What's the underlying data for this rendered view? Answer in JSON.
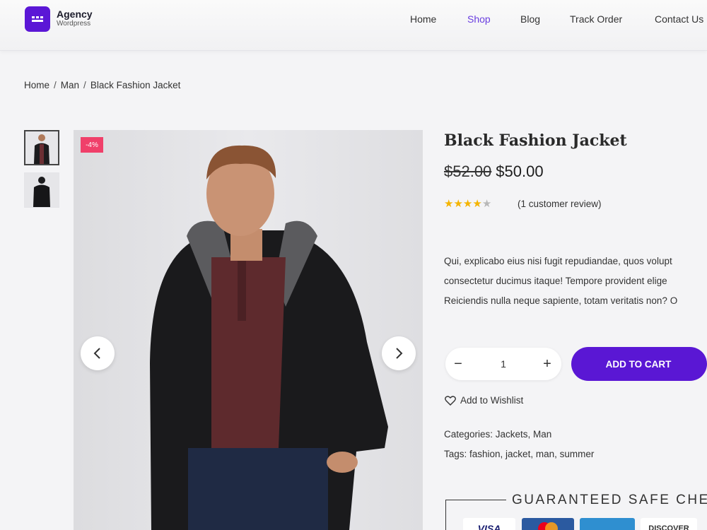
{
  "brand": {
    "name": "Agency",
    "sub": "Wordpress"
  },
  "nav": {
    "items": [
      "Home",
      "Shop",
      "Blog",
      "Track Order",
      "Contact Us"
    ],
    "active": "Shop"
  },
  "breadcrumb": {
    "items": [
      "Home",
      "Man",
      "Black Fashion Jacket"
    ]
  },
  "gallery": {
    "sale_badge": "-4%"
  },
  "product": {
    "title": "Black Fashion Jacket",
    "old_price": "$52.00",
    "price": "$50.00",
    "rating": 4,
    "rating_max": 5,
    "review_text": "(1 customer review)",
    "description": [
      "Qui, explicabo eius nisi fugit repudiandae, quos volupt",
      "consectetur ducimus itaque! Tempore provident elige",
      "Reiciendis nulla neque sapiente, totam veritatis non? O"
    ],
    "quantity": "1",
    "add_to_cart": "ADD TO CART",
    "wishlist": "Add to Wishlist",
    "categories": "Categories: Jackets, Man",
    "tags": "Tags: fashion, jacket, man, summer"
  },
  "checkout": {
    "title": "GUARANTEED SAFE CHE",
    "payment_labels": [
      "VISA",
      "DISCOVER"
    ]
  },
  "colors": {
    "accent": "#5a17d4",
    "nav_active": "#6a3ee0",
    "sale_badge": "#f0406a",
    "star": "#f4b400"
  }
}
